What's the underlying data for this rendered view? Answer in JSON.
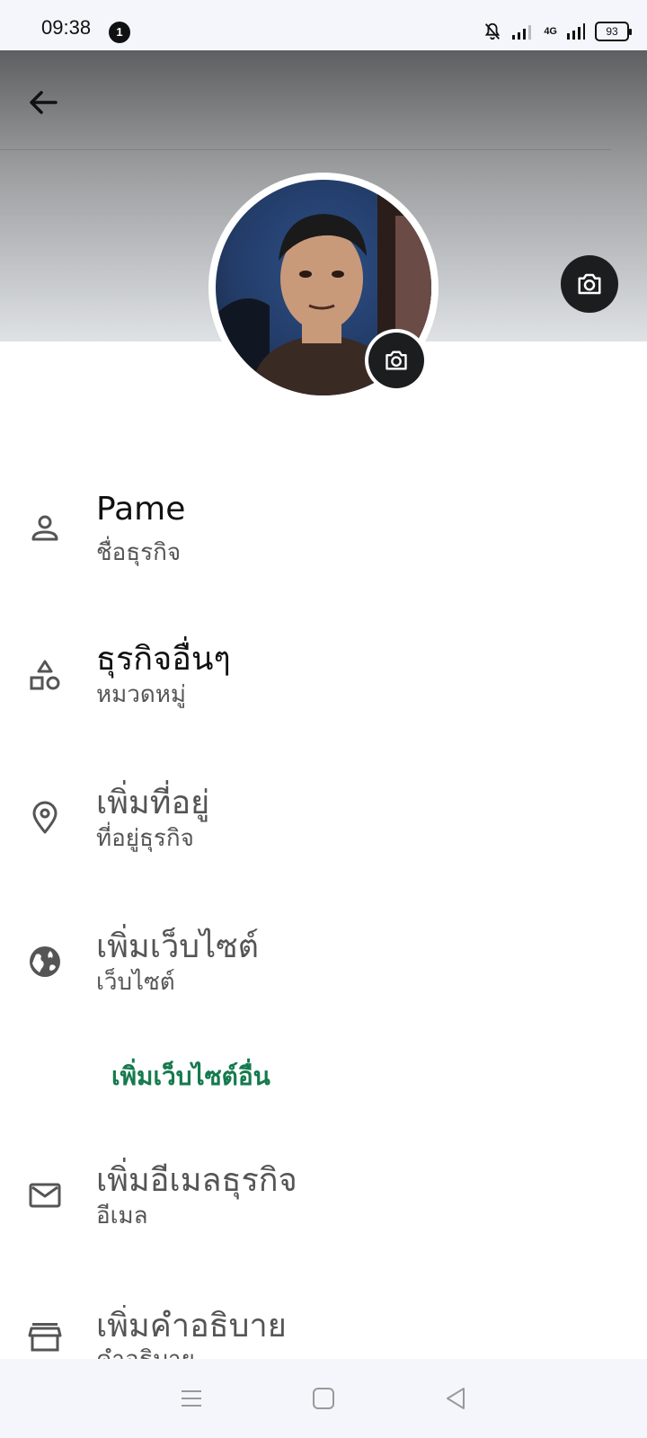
{
  "status_bar": {
    "time": "09:38",
    "notification_count": "1",
    "network": "4G",
    "battery": "93"
  },
  "profile": {
    "rows": [
      {
        "title": "Pame",
        "subtitle": "ชื่อธุรกิจ",
        "icon": "person-icon"
      },
      {
        "title": "ธุรกิจอื่นๆ",
        "subtitle": "หมวดหมู่",
        "icon": "category-icon"
      },
      {
        "title": "เพิ่มที่อยู่",
        "subtitle": "ที่อยู่ธุรกิจ",
        "icon": "location-pin-icon"
      },
      {
        "title": "เพิ่มเว็บไซต์",
        "subtitle": "เว็บไซต์",
        "icon": "globe-icon"
      },
      {
        "title": "เพิ่มอีเมลธุรกิจ",
        "subtitle": "อีเมล",
        "icon": "mail-icon"
      },
      {
        "title": "เพิ่มคำอธิบาย",
        "subtitle": "คำอธิบาย",
        "icon": "store-icon"
      }
    ],
    "add_website_link": "เพิ่มเว็บไซต์อื่น"
  },
  "colors": {
    "accent_green": "#157a4e",
    "dark_button": "#1b1d1f"
  }
}
